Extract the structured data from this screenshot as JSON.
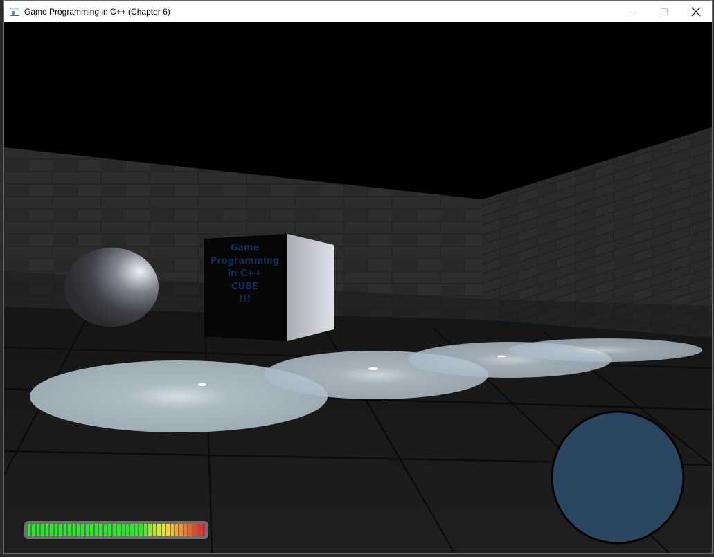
{
  "window": {
    "title": "Game Programming in C++ (Chapter 6)",
    "minimize_icon": "minimize-icon",
    "maximize_icon": "maximize-icon",
    "close_icon": "close-icon"
  },
  "scene": {
    "cube_label_lines": [
      "Game",
      "Programming",
      "in C++",
      "CUBE",
      "!!!"
    ],
    "colors": {
      "sky": "#000000",
      "wall": "#2b2b2b",
      "floor": "#1c1c1c",
      "spotlight": "#c9d8e2",
      "radar": "#2c4a66",
      "cube_text": "#1b2d63"
    }
  },
  "hud": {
    "health": {
      "segments": 40,
      "filled": 40,
      "colors": [
        "#22ee22",
        "#22ee22",
        "#22ee22",
        "#22ee22",
        "#22ee22",
        "#22ee22",
        "#22ee22",
        "#22ee22",
        "#22ee22",
        "#22ee22",
        "#22ee22",
        "#22ee22",
        "#22ee22",
        "#22ee22",
        "#22ee22",
        "#22ee22",
        "#22ee22",
        "#22ee22",
        "#22ee22",
        "#22ee22",
        "#22ee22",
        "#22ee22",
        "#22ee22",
        "#22ee22",
        "#22ee22",
        "#22ee22",
        "#55ee22",
        "#88ee22",
        "#b4ee22",
        "#d8ee22",
        "#eee822",
        "#f4d822",
        "#f6c022",
        "#f6a822",
        "#f69022",
        "#f67822",
        "#f26022",
        "#ee4422",
        "#ea3022",
        "#e62222"
      ]
    },
    "radar": {
      "icon": "radar-icon"
    }
  }
}
